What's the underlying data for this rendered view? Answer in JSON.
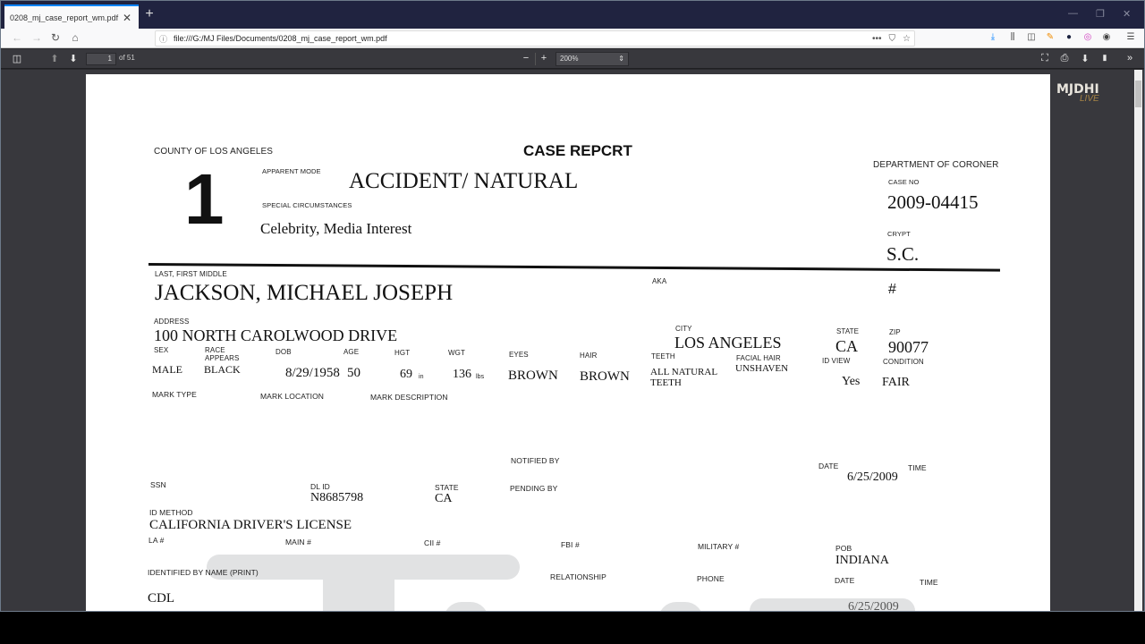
{
  "browser": {
    "tab_title": "0208_mj_case_report_wm.pdf",
    "tab_close": "✕",
    "new_tab": "+",
    "window_controls": {
      "minimize": "—",
      "restore": "❐",
      "close": "✕"
    },
    "nav": {
      "back": "←",
      "forward": "→",
      "reload": "↻",
      "home": "⌂"
    },
    "url_info_icon": "ⓘ",
    "url": "file:///G:/MJ Files/Documents/0208_mj_case_report_wm.pdf",
    "url_actions": {
      "more": "•••",
      "pocket": "⛉",
      "bookmark": "☆"
    },
    "toolbar_icons": {
      "downloads": "⤓",
      "library": "⫼",
      "sidebar": "◫",
      "ext1": "✎",
      "ext2": "●",
      "ext3": "◎",
      "account": "◉",
      "menu": "☰"
    }
  },
  "pdf_toolbar": {
    "sidebar_toggle": "◫",
    "prev_page": "⬆",
    "next_page": "⬇",
    "page_number": "1",
    "page_count": "of 51",
    "zoom_out": "−",
    "zoom_in": "+",
    "zoom_level": "200%",
    "zoom_arrow": "⇕",
    "presentation": "⛶",
    "print": "⎙",
    "save": "⬇",
    "bookmark": "🔖",
    "tools": "»"
  },
  "watermark": {
    "logo_text": "MJDHI",
    "logo_sub": "LIVE"
  },
  "document": {
    "county": "COUNTY OF LOS ANGELES",
    "title": "CASE REPCRT",
    "department": "DEPARTMENT OF CORONER",
    "big_number": "1",
    "apparent_mode_label": "APPARENT MODE",
    "apparent_mode": "ACCIDENT/ NATURAL",
    "special_circumstances_label": "SPECIAL CIRCUMSTANCES",
    "special_circumstances": "Celebrity, Media Interest",
    "case_no_label": "CASE NO",
    "case_no": "2009-04415",
    "crypt_label": "CRYPT",
    "crypt": "S.C.",
    "name_label": "LAST, FIRST MIDDLE",
    "name": "JACKSON, MICHAEL JOSEPH",
    "aka_label": "AKA",
    "hash_label": "#",
    "address_label": "ADDRESS",
    "address": "100 NORTH CAROLWOOD DRIVE",
    "city_label": "CITY",
    "city": "LOS ANGELES",
    "state_label": "STATE",
    "state": "CA",
    "zip_label": "ZIP",
    "zip": "90077",
    "sex_label": "SEX",
    "sex": "MALE",
    "race_label": "RACE\nAPPEARS",
    "race": "BLACK",
    "dob_label": "DOB",
    "dob": "8/29/1958",
    "age_label": "AGE",
    "age": "50",
    "hgt_label": "HGT",
    "hgt": "69",
    "hgt_unit": "in",
    "wgt_label": "WGT",
    "wgt": "136",
    "wgt_unit": "lbs",
    "eyes_label": "EYES",
    "eyes": "BROWN",
    "hair_label": "HAIR",
    "hair": "BROWN",
    "teeth_label": "TEETH",
    "teeth": "ALL NATURAL TEETH",
    "facial_hair_label": "FACIAL HAIR",
    "facial_hair": "UNSHAVEN",
    "id_view_label": "ID VIEW",
    "id_view": "Yes",
    "condition_label": "CONDITION",
    "condition": "FAIR",
    "mark_type_label": "MARK TYPE",
    "mark_location_label": "MARK LOCATION",
    "mark_description_label": "MARK DESCRIPTION",
    "notified_by_label": "NOTIFIED BY",
    "pending_by_label": "PENDING BY",
    "date_label": "DATE",
    "time_label": "TIME",
    "notified_date": "6/25/2009",
    "ssn_label": "SSN",
    "dl_id_label": "DL ID",
    "dl_id": "N8685798",
    "dl_state_label": "STATE",
    "dl_state": "CA",
    "id_method_label": "ID METHOD",
    "id_method": "CALIFORNIA DRIVER'S LICENSE",
    "la_no_label": "LA #",
    "main_no_label": "MAIN #",
    "cii_no_label": "CII #",
    "fbi_no_label": "FBI #",
    "military_no_label": "MILITARY #",
    "pob_label": "POB",
    "pob": "INDIANA",
    "identified_by_label": "IDENTIFIED BY  NAME (PRINT)",
    "identified_by": "CDL",
    "relationship_label": "RELATIONSHIP",
    "phone_label": "PHONE",
    "identified_date_label": "DATE",
    "identified_time_label": "TIME",
    "identified_date": "6/25/2009"
  }
}
